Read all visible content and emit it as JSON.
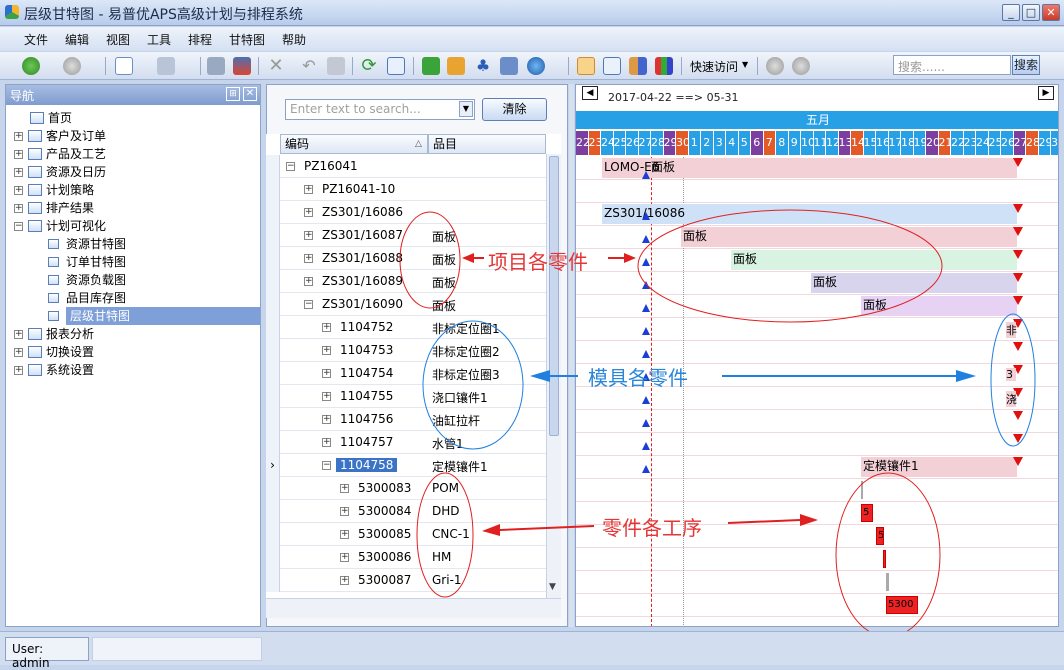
{
  "window": {
    "title": "层级甘特图 - 易普优APS高级计划与排程系统",
    "min": "_",
    "max": "□",
    "close": "✕"
  },
  "menu": [
    "文件",
    "编辑",
    "视图",
    "工具",
    "排程",
    "甘特图",
    "帮助"
  ],
  "toolbar": {
    "quick_access": "快速访问",
    "search_placeholder": "搜索......",
    "search_button": "搜索"
  },
  "nav": {
    "title": "导航",
    "items": [
      {
        "label": "首页",
        "level": 1
      },
      {
        "label": "客户及订单",
        "level": 0
      },
      {
        "label": "产品及工艺",
        "level": 0
      },
      {
        "label": "资源及日历",
        "level": 0
      },
      {
        "label": "计划策略",
        "level": 0
      },
      {
        "label": "排产结果",
        "level": 0
      },
      {
        "label": "计划可视化",
        "level": 0
      },
      {
        "label": "资源甘特图",
        "level": 2
      },
      {
        "label": "订单甘特图",
        "level": 2
      },
      {
        "label": "资源负载图",
        "level": 2
      },
      {
        "label": "品目库存图",
        "level": 2
      },
      {
        "label": "层级甘特图",
        "level": 2,
        "selected": true
      },
      {
        "label": "报表分析",
        "level": 0
      },
      {
        "label": "切换设置",
        "level": 0
      },
      {
        "label": "系统设置",
        "level": 0
      }
    ]
  },
  "grid": {
    "search_placeholder": "Enter text to search...",
    "clear_button": "清除",
    "col_code": "编码",
    "col_name": "品目",
    "rows": [
      {
        "code": "PZ16041",
        "name": "",
        "indent": 0,
        "exp": "−"
      },
      {
        "code": "PZ16041-10",
        "name": "",
        "indent": 1,
        "exp": "+"
      },
      {
        "code": "ZS301/16086",
        "name": "",
        "indent": 1,
        "exp": "+"
      },
      {
        "code": "ZS301/16087",
        "name": "面板",
        "indent": 1,
        "exp": "+"
      },
      {
        "code": "ZS301/16088",
        "name": "面板",
        "indent": 1,
        "exp": "+"
      },
      {
        "code": "ZS301/16089",
        "name": "面板",
        "indent": 1,
        "exp": "+"
      },
      {
        "code": "ZS301/16090",
        "name": "面板",
        "indent": 1,
        "exp": "−"
      },
      {
        "code": "1104752",
        "name": "非标定位圈1",
        "indent": 2,
        "exp": "+"
      },
      {
        "code": "1104753",
        "name": "非标定位圈2",
        "indent": 2,
        "exp": "+"
      },
      {
        "code": "1104754",
        "name": "非标定位圈3",
        "indent": 2,
        "exp": "+"
      },
      {
        "code": "1104755",
        "name": "浇口镶件1",
        "indent": 2,
        "exp": "+"
      },
      {
        "code": "1104756",
        "name": "油缸拉杆",
        "indent": 2,
        "exp": "+"
      },
      {
        "code": "1104757",
        "name": "水管1",
        "indent": 2,
        "exp": "+"
      },
      {
        "code": "1104758",
        "name": "定模镶件1",
        "indent": 2,
        "exp": "−",
        "selected": true
      },
      {
        "code": "5300083",
        "name": "POM",
        "indent": 3,
        "exp": "+"
      },
      {
        "code": "5300084",
        "name": "DHD",
        "indent": 3,
        "exp": "+"
      },
      {
        "code": "5300085",
        "name": "CNC-1",
        "indent": 3,
        "exp": "+"
      },
      {
        "code": "5300086",
        "name": "HM",
        "indent": 3,
        "exp": "+"
      },
      {
        "code": "5300087",
        "name": "Gri-1",
        "indent": 3,
        "exp": "+"
      }
    ]
  },
  "gantt": {
    "date_range": "2017-04-22 ==> 05-31",
    "month": "五月",
    "days": [
      "22",
      "23",
      "24",
      "25",
      "26",
      "27",
      "28",
      "29",
      "30",
      "1",
      "2",
      "3",
      "4",
      "5",
      "6",
      "7",
      "8",
      "9",
      "10",
      "11",
      "12",
      "13",
      "14",
      "15",
      "16",
      "17",
      "18",
      "19",
      "20",
      "21",
      "22",
      "23",
      "24",
      "25",
      "26",
      "27",
      "28",
      "29",
      "30"
    ],
    "bars": [
      "LOMO-E6",
      "面板",
      "ZS301/16086",
      "面板",
      "面板",
      "面板",
      "面板",
      "定模镶件1",
      "5",
      "5",
      "5300"
    ],
    "small_labels": [
      "非",
      "3",
      "浇"
    ],
    "colors": {
      "sat": "#7b3fa0",
      "sun": "#e35a27",
      "weekday": "#27a0e6",
      "bar_pink": "#f3cfd6",
      "bar_blue": "#cfe1f6",
      "bar_green": "#d8f3e2",
      "bar_lavender": "#d8d4ee",
      "bar_purple": "#e7d2f4",
      "op_red": "#ee2222"
    }
  },
  "annotations": {
    "a1": "项目各零件",
    "a2": "模具各零件",
    "a3": "零件各工序"
  },
  "status": {
    "user": "User: admin"
  }
}
